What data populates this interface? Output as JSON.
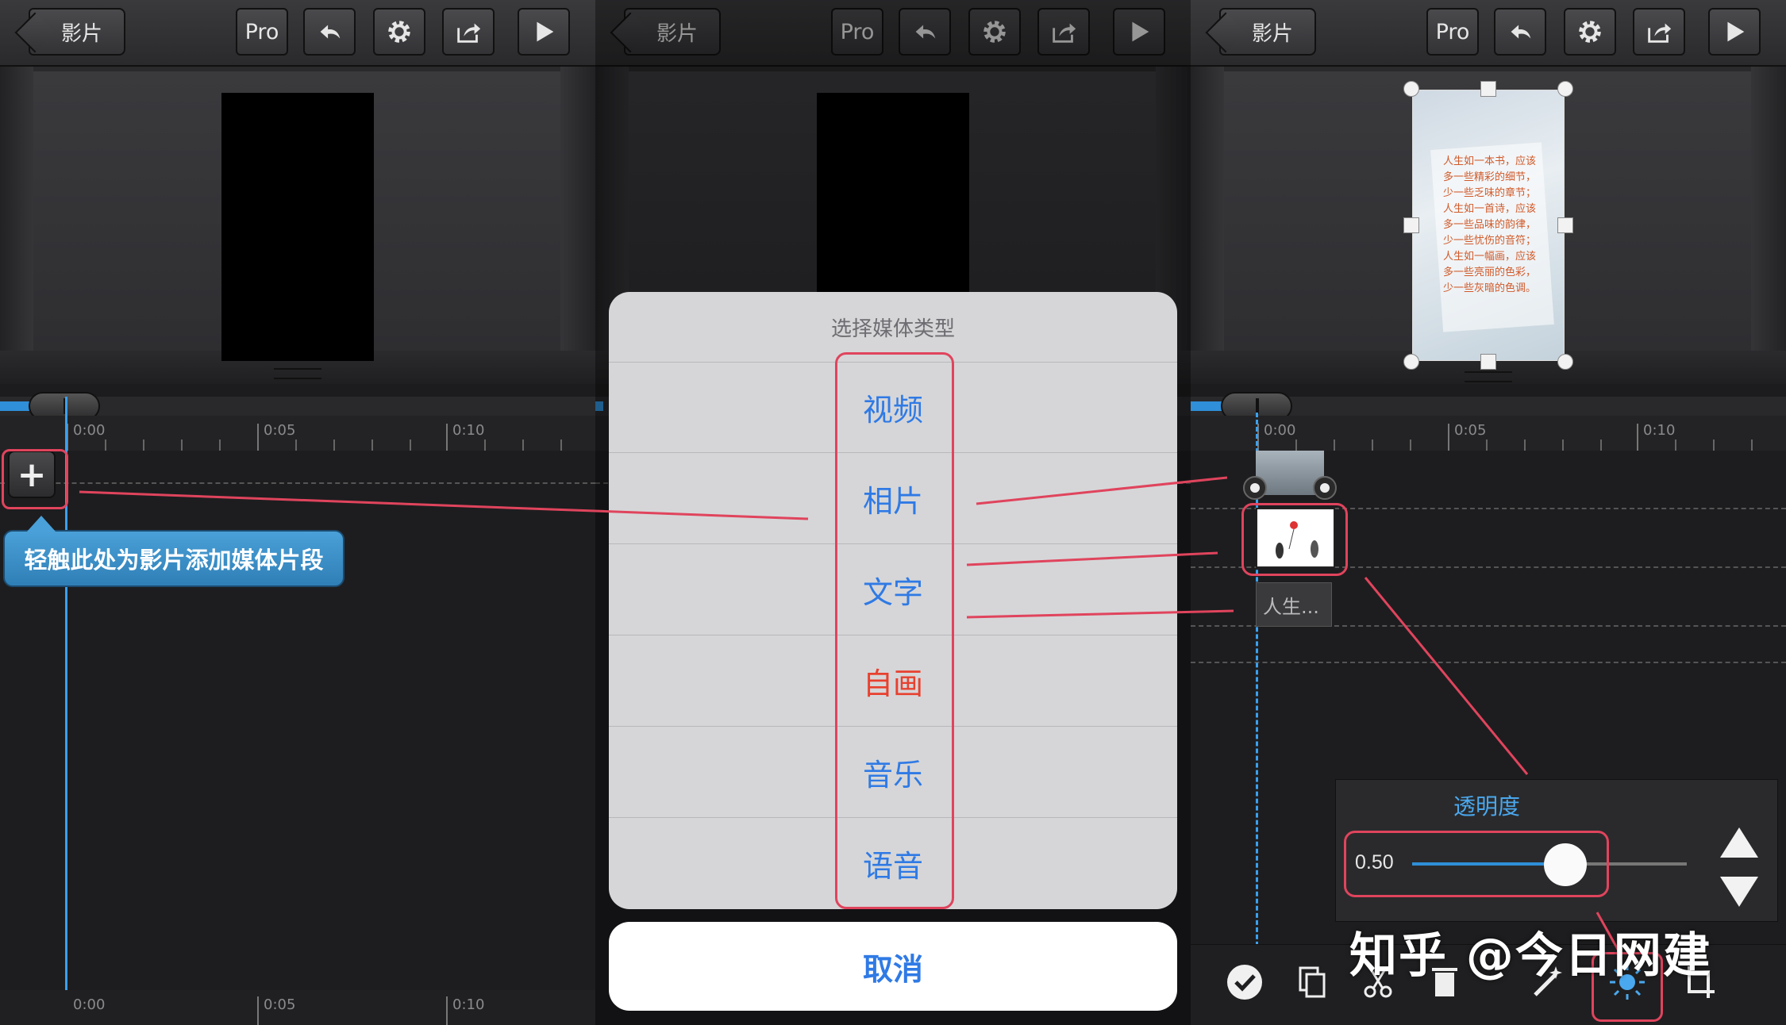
{
  "toolbar": {
    "back_label": "影片",
    "pro_label": "Pro"
  },
  "ruler": {
    "t0": "0:00",
    "t5": "0:05",
    "t10": "0:10"
  },
  "panel1": {
    "tooltip": "轻触此处为影片添加媒体片段"
  },
  "media_sheet": {
    "title": "选择媒体类型",
    "options": [
      "视频",
      "相片",
      "文字",
      "自画",
      "音乐",
      "语音"
    ],
    "cancel": "取消"
  },
  "panel3": {
    "poster_text": "人生如一本书，应该多一些精彩的细节，少一些乏味的章节；人生如一首诗，应该多一些品味的韵律，少一些忧伤的音符；人生如一幅画，应该多一些亮丽的色彩，少一些灰暗的色调。",
    "text_clip": "人生...",
    "opacity_title": "透明度",
    "opacity_value": "0.50",
    "opacity_fraction": 0.5
  },
  "watermark": "知乎 @今日网建",
  "colors": {
    "accent_blue": "#2f7ae5",
    "highlight_red": "#e0445d",
    "draw_red": "#e8402f",
    "tooltip_blue": "#3b8fc8"
  },
  "icons": [
    "back-arrow-icon",
    "undo-icon",
    "gear-icon",
    "share-icon",
    "play-icon",
    "plus-icon",
    "check-icon",
    "copy-icon",
    "scissors-icon",
    "trash-icon",
    "wand-icon",
    "brightness-icon",
    "crop-icon",
    "arrow-up-icon",
    "arrow-down-icon"
  ]
}
